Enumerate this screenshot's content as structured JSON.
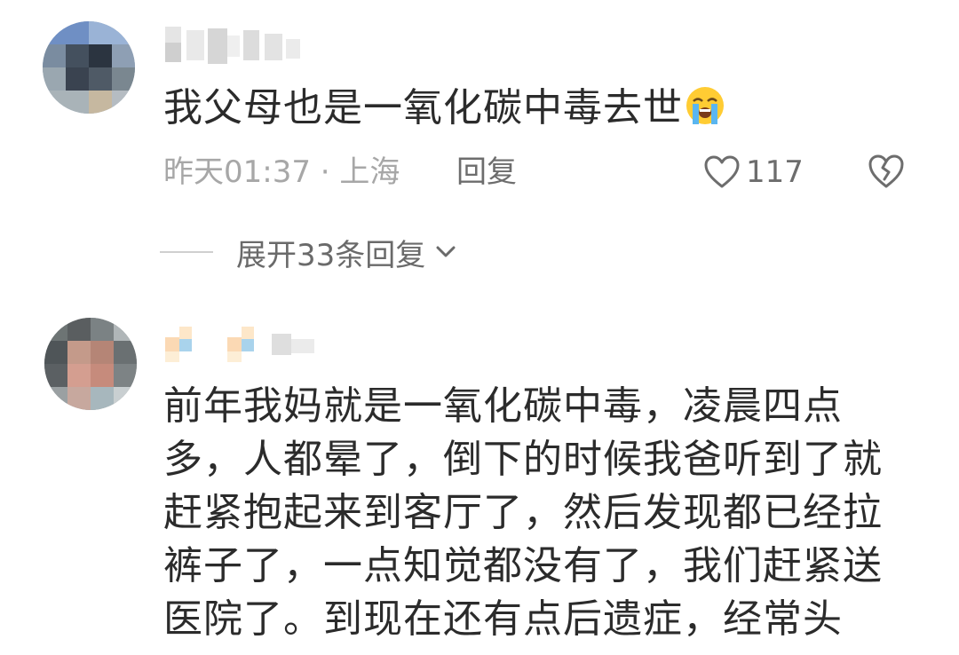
{
  "comments": [
    {
      "text": "我父母也是一氧化碳中毒去世",
      "emoji": "loudly-crying-face",
      "time_location": "昨天01:37 · 上海",
      "reply_label": "回复",
      "like_count": "117",
      "expand_label": "展开33条回复"
    },
    {
      "text": "前年我妈就是一氧化碳中毒，凌晨四点多，人都晕了，倒下的时候我爸听到了就赶紧抱起来到客厅了，然后发现都已经拉裤子了，一点知觉都没有了，我们赶紧送医院了。到现在还有点后遗症，经常头"
    }
  ],
  "icons": {
    "like": "heart-outline-icon",
    "dislike": "broken-heart-icon",
    "expand": "chevron-down-icon"
  },
  "colors": {
    "text": "#2b2b2b",
    "meta": "#a7a7a7",
    "action": "#6d6d6d"
  }
}
